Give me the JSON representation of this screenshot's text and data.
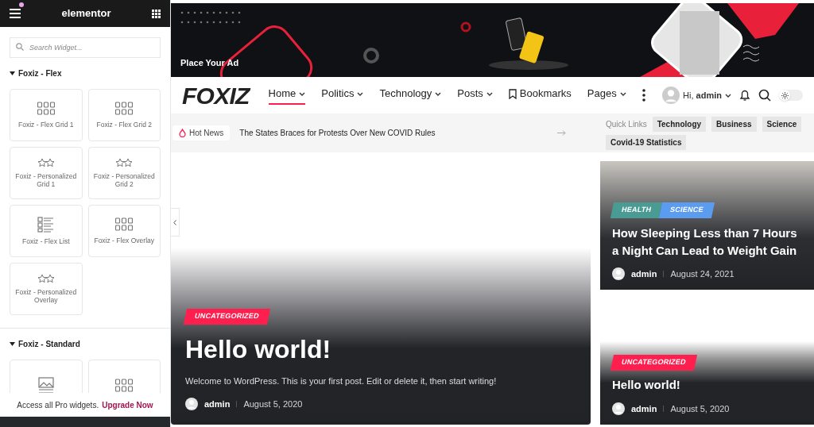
{
  "sidebar": {
    "title": "elementor",
    "search": {
      "placeholder": "Search Widget..."
    },
    "sections": [
      {
        "title": "Foxiz - Flex",
        "expanded": true,
        "widgets": [
          {
            "label": "Foxiz - Flex Grid 1",
            "kind": "grid"
          },
          {
            "label": "Foxiz - Flex Grid 2",
            "kind": "grid"
          },
          {
            "label": "Foxiz - Personalized Grid 1",
            "kind": "stars"
          },
          {
            "label": "Foxiz - Personalized Grid 2",
            "kind": "stars"
          },
          {
            "label": "Foxiz - Flex List",
            "kind": "list"
          },
          {
            "label": "Foxiz - Flex Overlay",
            "kind": "grid"
          },
          {
            "label": "Foxiz - Personalized Overlay",
            "kind": "stars"
          }
        ]
      },
      {
        "title": "Foxiz - Standard",
        "expanded": true,
        "widgets": [
          {
            "kind": "image"
          },
          {
            "kind": "grid"
          }
        ]
      }
    ],
    "promo": {
      "text": "Access all Pro widgets.",
      "link": "Upgrade Now"
    }
  },
  "ad": {
    "label": "Place Your Ad"
  },
  "nav": {
    "logo": "FOXIZ",
    "items": [
      {
        "label": "Home",
        "selected": true,
        "kind": "dropdown"
      },
      {
        "label": "Politics",
        "selected": false,
        "kind": "dropdown"
      },
      {
        "label": "Technology",
        "selected": false,
        "kind": "dropdown"
      },
      {
        "label": "Posts",
        "selected": false,
        "kind": "dropdown"
      },
      {
        "label": "Bookmarks",
        "selected": false,
        "kind": "bookmark"
      },
      {
        "label": "Pages",
        "selected": false,
        "kind": "dropdown"
      }
    ],
    "user": "Hi, ",
    "username": "admin",
    "dark_mode": false
  },
  "ticker": {
    "badge": "Hot News",
    "headline": "The States Braces for Protests Over New COVID Rules",
    "quick_links_label": "Quick Links",
    "quick_links": [
      "Technology",
      "Business",
      "Science",
      "Covid-19 Statistics"
    ]
  },
  "hero": {
    "tags": [
      {
        "label": "UNCATEGORIZED",
        "color": "#ff1f4f"
      }
    ],
    "title": "Hello world!",
    "excerpt": "Welcome to WordPress. This is your first post. Edit or delete it, then start writing!",
    "author": "admin",
    "date": "August 5, 2020"
  },
  "side_posts": [
    {
      "tags": [
        {
          "label": "HEALTH",
          "color": "#4a9b94"
        },
        {
          "label": "SCIENCE",
          "color": "#5b9cf0"
        }
      ],
      "title": "How Sleeping Less than 7 Hours a Night Can Lead to Weight Gain",
      "author": "admin",
      "date": "August 24, 2021",
      "photo": true
    },
    {
      "tags": [
        {
          "label": "UNCATEGORIZED",
          "color": "#ff1f4f"
        }
      ],
      "title": "Hello world!",
      "author": "admin",
      "date": "August 5, 2020",
      "photo": false
    }
  ]
}
